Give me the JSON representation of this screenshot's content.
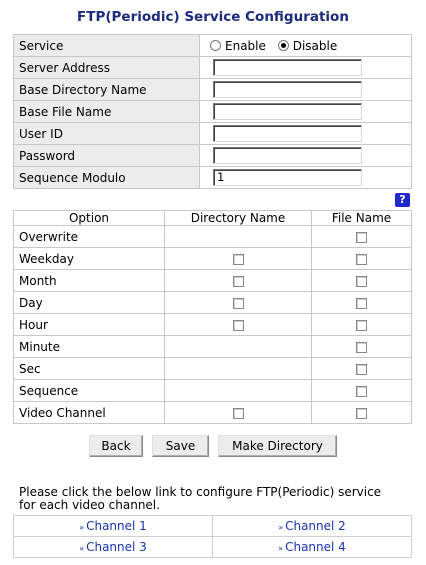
{
  "page": {
    "title": "FTP(Periodic) Service Configuration"
  },
  "config": {
    "service_label": "Service",
    "enable_label": "Enable",
    "disable_label": "Disable",
    "service_selected": "Disable",
    "server_address_label": "Server Address",
    "server_address_value": "",
    "base_dir_label": "Base Directory Name",
    "base_dir_value": "",
    "base_file_label": "Base File Name",
    "base_file_value": "",
    "user_id_label": "User ID",
    "user_id_value": "",
    "password_label": "Password",
    "password_value": "",
    "seq_modulo_label": "Sequence Modulo",
    "seq_modulo_value": "1"
  },
  "help": {
    "label": "?"
  },
  "options": {
    "headers": [
      "Option",
      "Directory Name",
      "File Name"
    ],
    "rows": [
      {
        "label": "Overwrite",
        "has_dir": false,
        "dir_checked": false,
        "file_checked": false
      },
      {
        "label": "Weekday",
        "has_dir": true,
        "dir_checked": false,
        "file_checked": false
      },
      {
        "label": "Month",
        "has_dir": true,
        "dir_checked": false,
        "file_checked": false
      },
      {
        "label": "Day",
        "has_dir": true,
        "dir_checked": false,
        "file_checked": false
      },
      {
        "label": "Hour",
        "has_dir": true,
        "dir_checked": false,
        "file_checked": false
      },
      {
        "label": "Minute",
        "has_dir": false,
        "dir_checked": false,
        "file_checked": false
      },
      {
        "label": "Sec",
        "has_dir": false,
        "dir_checked": false,
        "file_checked": false
      },
      {
        "label": "Sequence",
        "has_dir": false,
        "dir_checked": false,
        "file_checked": false
      },
      {
        "label": "Video Channel",
        "has_dir": true,
        "dir_checked": false,
        "file_checked": false
      }
    ]
  },
  "buttons": {
    "back": "Back",
    "save": "Save",
    "make_dir": "Make Directory"
  },
  "note": "Please click the below link to configure FTP(Periodic) service for each video channel.",
  "channels": {
    "chevron": "»",
    "items": [
      "Channel 1",
      "Channel 2",
      "Channel 3",
      "Channel 4"
    ]
  }
}
